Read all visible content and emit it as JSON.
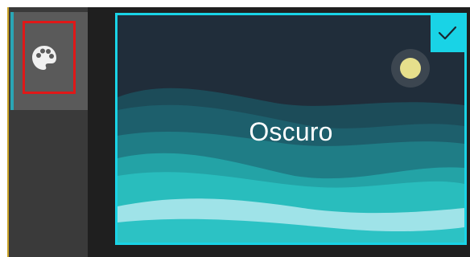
{
  "sidebar": {
    "items": [
      {
        "icon": "palette-icon",
        "active": true,
        "highlighted": true
      }
    ]
  },
  "theme_picker": {
    "selected_theme": {
      "label": "Oscuro",
      "selected": true,
      "icon": "check-icon"
    }
  },
  "colors": {
    "accent": "#19d3e6",
    "highlight": "#e01818",
    "sidebar_background": "#3a3a3a",
    "sidebar_item_active": "#5a5a5a",
    "content_background": "#1f1f1f"
  }
}
